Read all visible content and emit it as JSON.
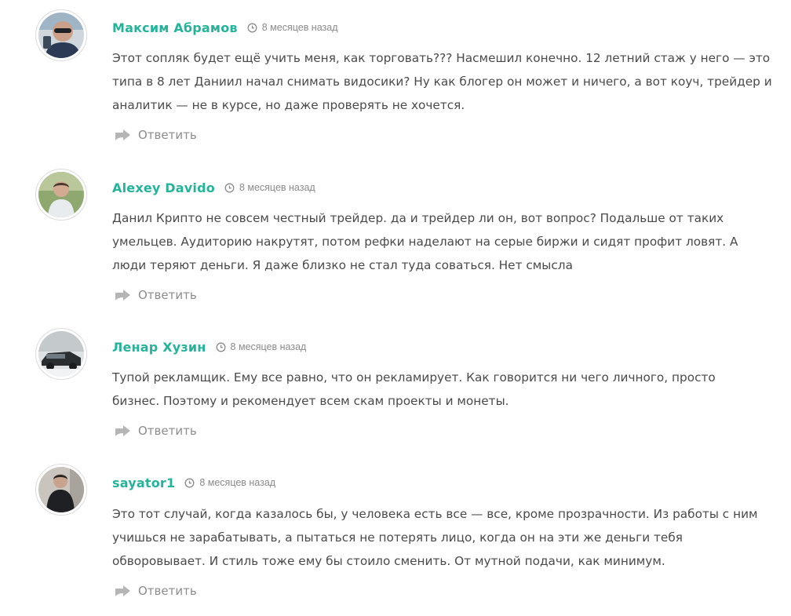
{
  "comments": [
    {
      "author": "Максим Абрамов",
      "time": "8 месяцев назад",
      "text_lines": [
        "Этот сопляк будет ещё учить меня, как торговать??? Насмешил конечно. 12 летний стаж у него — это",
        "типа в 8 лет Даниил начал снимать видосики? Ну как блогер он может и ничего, а вот коуч, трейдер и",
        "аналитик — не в курсе, но даже проверять не хочется."
      ],
      "reply_label": "Ответить"
    },
    {
      "author": "Alexey Davido",
      "time": "8 месяцев назад",
      "text_lines": [
        "Данил Крипто не совсем честный трейдер. да и трейдер ли он, вот вопрос? Подальше от таких",
        "умельцев. Аудиторию накрутят, потом рефки наделают на серые биржи и сидят профит ловят. А",
        "люди теряют деньги. Я даже близко не стал туда соваться. Нет смысла"
      ],
      "reply_label": "Ответить"
    },
    {
      "author": "Ленар Хузин",
      "time": "8 месяцев назад",
      "text_lines": [
        "Тупой рекламщик. Ему все равно, что он рекламирует. Как говорится ни чего личного, просто",
        "бизнес. Поэтому и рекомендует всем скам проекты и монеты."
      ],
      "reply_label": "Ответить"
    },
    {
      "author": "sayator1",
      "time": "8 месяцев назад",
      "text_lines": [
        "Это тот случай, когда казалось бы, у человека есть все — все, кроме прозрачности. Из работы с ним",
        "учишься не зарабатывать, а пытаться не потерять лицо, когда он на эти же деньги тебя",
        "обворовывает. И стиль тоже ему бы стоило сменить. От мутной подачи, как минимум."
      ],
      "reply_label": "Ответить"
    }
  ],
  "colors": {
    "author": "#25b39a",
    "meta": "#8a8a8a",
    "text": "#4a4a4a",
    "reply": "#8c8c8c",
    "reply_icon": "#b5b5b5"
  },
  "icons": {
    "time": "clock-icon",
    "reply": "reply-arrow-icon"
  }
}
